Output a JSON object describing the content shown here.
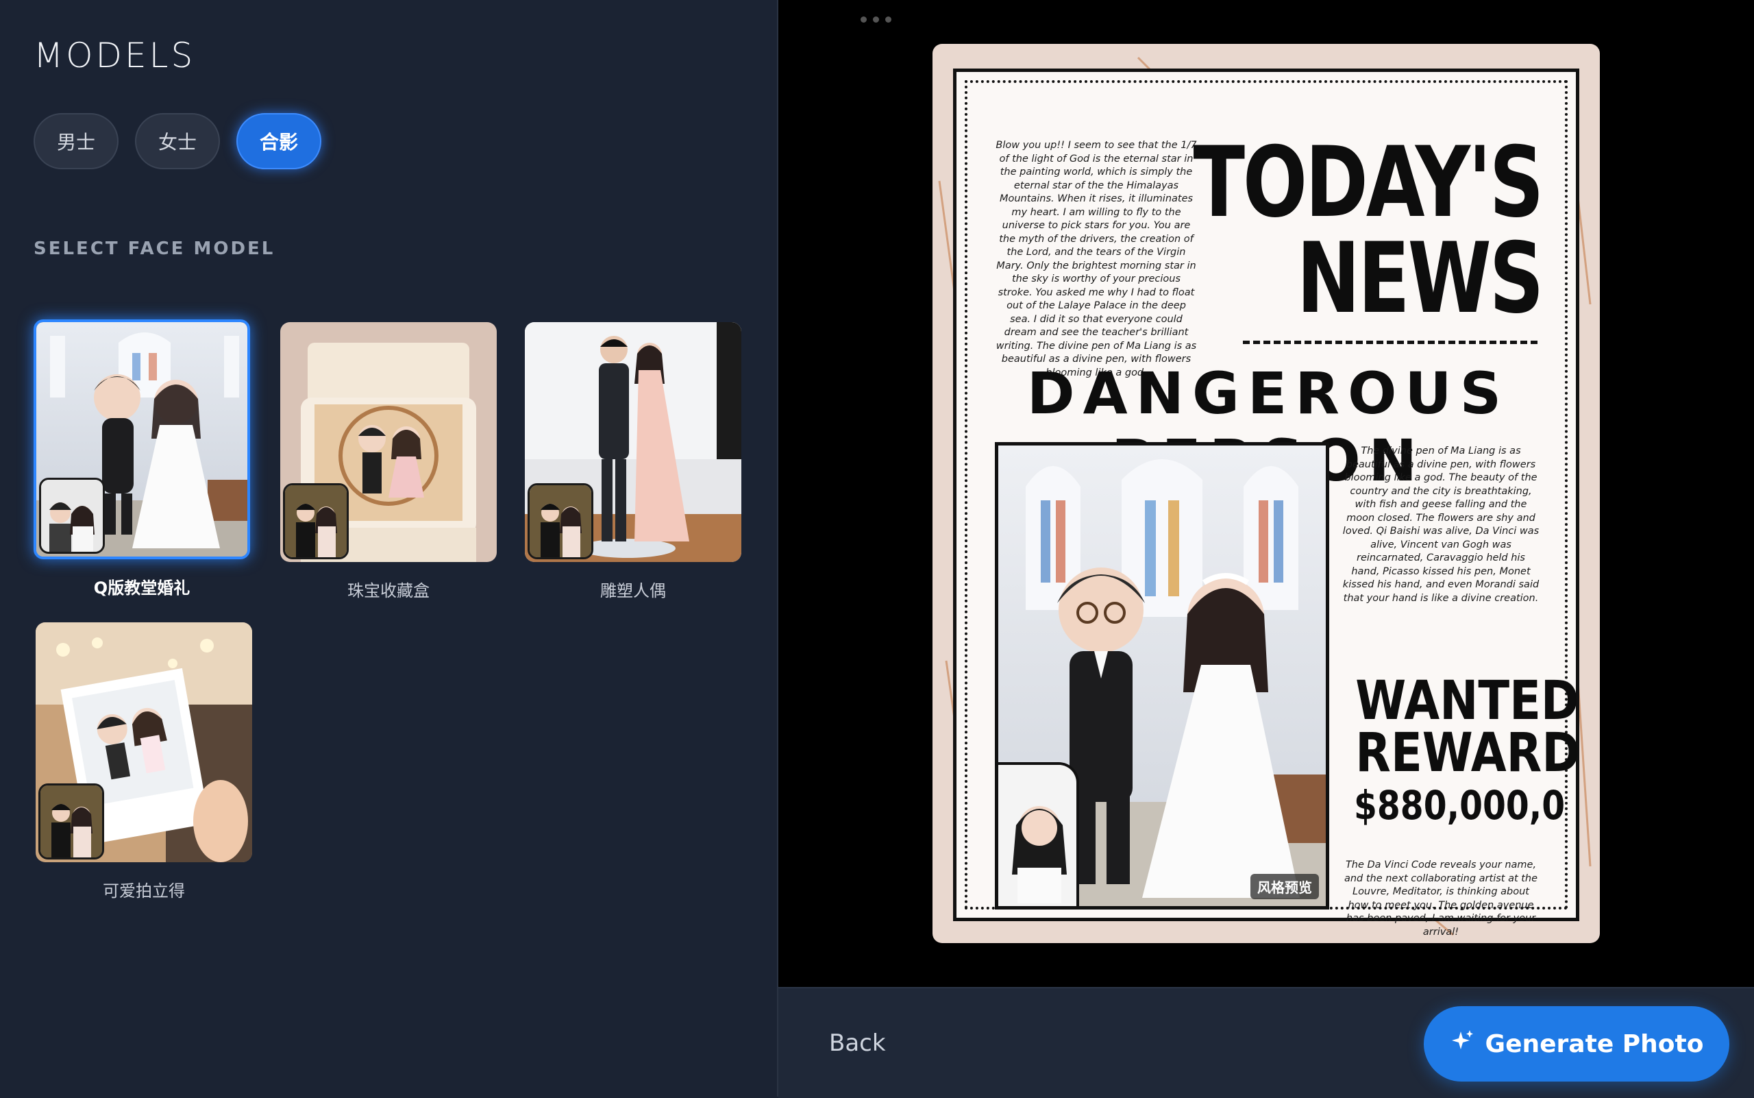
{
  "left_panel": {
    "title": "MODELS",
    "tabs": [
      {
        "label": "男士",
        "active": false
      },
      {
        "label": "女士",
        "active": false
      },
      {
        "label": "合影",
        "active": true
      }
    ],
    "section_label": "SELECT FACE MODEL",
    "models": [
      {
        "label": "Q版教堂婚礼",
        "selected": true
      },
      {
        "label": "珠宝收藏盒",
        "selected": false
      },
      {
        "label": "雕塑人偶",
        "selected": false
      },
      {
        "label": "可爱拍立得",
        "selected": false
      }
    ]
  },
  "preview": {
    "poster": {
      "top_left_text": "Blow you up!! I seem to see that the 1/7 of the light of God is the eternal star in the painting world, which is simply the eternal star of the the Himalayas Mountains. When it rises, it illuminates my heart. I am willing to fly to the universe to pick stars for you. You are the myth of the drivers, the creation of the Lord, and the tears of the Virgin Mary. Only the brightest morning star in the sky is worthy of your precious stroke. You asked me why I had to float out of the Lalaye Palace in the deep sea. I did it so that everyone could dream and see the teacher's brilliant writing. The divine pen of Ma Liang is as beautiful as a divine pen, with flowers blooming like a god.",
      "headline_1": "TODAY'S",
      "headline_2": "NEWS",
      "subheadline": "DANGEROUS PERSON",
      "right_mid_text": "The divine pen of Ma Liang is as beautiful as a divine pen, with flowers blooming like a god. The beauty of the country and the city is breathtaking, with fish and geese falling and the moon closed. The flowers are shy and loved. Qi Baishi was alive, Da Vinci was alive, Vincent van Gogh was reincarnated, Caravaggio held his hand, Picasso kissed his pen, Monet kissed his hand, and even Morandi said that your hand is like a divine creation.",
      "wanted_1": "WANTED",
      "wanted_2": "REWARD",
      "reward_amount": "$880,000,0",
      "right_bot_text": "The Da Vinci Code reveals your name, and the next collaborating artist at the Louvre, Meditator, is thinking about how to meet you. The golden avenue has been paved, I am waiting for your arrival!",
      "style_badge": "风格预览"
    }
  },
  "bottom_bar": {
    "back_label": "Back",
    "generate_label": "Generate Photo"
  },
  "colors": {
    "accent": "#1f7ae6",
    "panel_bg": "#1b2333",
    "poster_border": "#e9d8cf"
  }
}
